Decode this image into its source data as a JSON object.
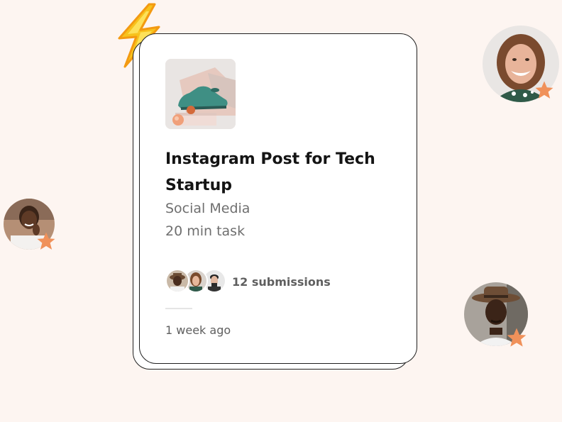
{
  "card": {
    "title": "Instagram Post for Tech Startup",
    "category": "Social Media",
    "duration": "20 min task",
    "submissions": "12 submissions",
    "time_ago": "1 week ago"
  },
  "colors": {
    "background": "#fdf5f1",
    "card_border": "#1f1f1f",
    "muted_text": "#6f6f6f",
    "star": "#f0915a",
    "bolt": "#f7c21c"
  },
  "icons": [
    "lightning-bolt-icon",
    "star-icon"
  ]
}
